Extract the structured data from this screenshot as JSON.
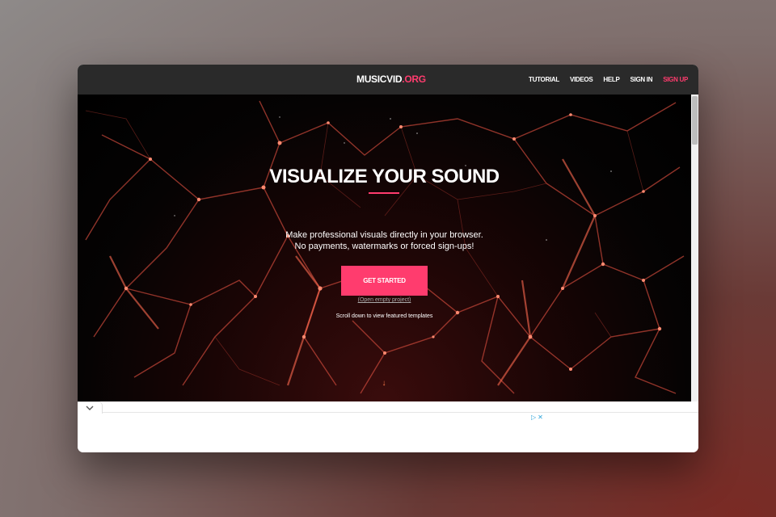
{
  "nav": {
    "logo_main": "MUSICVID",
    "logo_tld": ".ORG",
    "links": [
      "TUTORIAL",
      "VIDEOS",
      "HELP",
      "SIGN IN"
    ],
    "signup": "SIGN UP"
  },
  "hero": {
    "title": "VISUALIZE YOUR SOUND",
    "subtitle_line1": "Make professional visuals directly in your browser.",
    "subtitle_line2": "No payments, watermarks or forced sign-ups!",
    "cta": "GET STARTED",
    "empty_project": "(Open empty project)",
    "scroll_hint": "Scroll down to view featured templates",
    "scroll_arrow": "↓"
  },
  "ad": {
    "play_icon": "▷",
    "close_icon": "✕"
  },
  "colors": {
    "accent": "#ff3c6e",
    "navbar": "#2a2a2a"
  }
}
